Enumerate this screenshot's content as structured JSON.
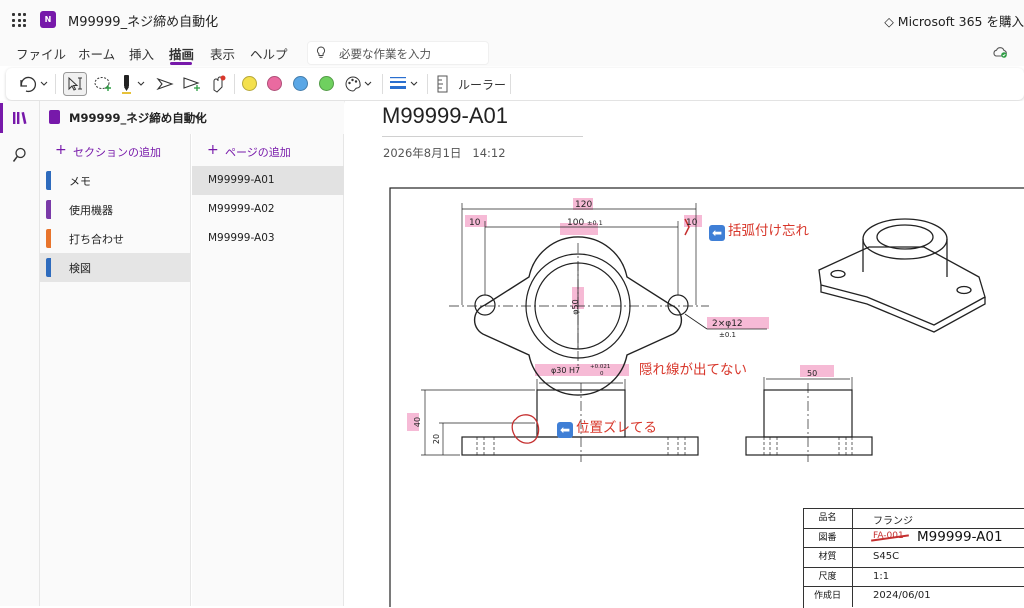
{
  "titlebar": {
    "app_badge": "N",
    "doc_title": "M99999_ネジ締め自動化",
    "m365_label": "Microsoft 365 を購入"
  },
  "menu": {
    "items": [
      "ファイル",
      "ホーム",
      "挿入",
      "描画",
      "表示",
      "ヘルプ"
    ],
    "active": "描画"
  },
  "search": {
    "placeholder": "必要な作業を入力"
  },
  "toolbar": {
    "ruler_label": "ルーラー",
    "pen_colors": [
      "#f4e04d",
      "#ea6aa0",
      "#5aa7e6",
      "#6fd05f"
    ]
  },
  "notebook": {
    "name": "M99999_ネジ締め自動化"
  },
  "sections": {
    "add_label": "セクションの追加",
    "items": [
      {
        "label": "メモ",
        "color": "#2e6bbd"
      },
      {
        "label": "使用機器",
        "color": "#7a3aa8"
      },
      {
        "label": "打ち合わせ",
        "color": "#e8742c"
      },
      {
        "label": "検図",
        "color": "#2e6bbd",
        "selected": true
      }
    ]
  },
  "pages": {
    "add_label": "ページの追加",
    "items": [
      {
        "label": "M99999-A01",
        "selected": true
      },
      {
        "label": "M99999-A02"
      },
      {
        "label": "M99999-A03"
      }
    ]
  },
  "page": {
    "title": "M99999-A01",
    "date": "2026年8月1日",
    "time": "14:12"
  },
  "drawing": {
    "dims": {
      "overall": "120",
      "center": "100",
      "center_tol": "±0.1",
      "edge_left": "10",
      "edge_right": "10",
      "bore": "φ50",
      "holes": "2×φ12",
      "holes_tol": "±0.1",
      "boss": "φ30 H7",
      "boss_tol_upper": "+0.021",
      "boss_tol_lower": "0",
      "height": "40",
      "base_h": "20",
      "side_w": "50"
    },
    "annotations": {
      "bracket": "括弧付け忘れ",
      "hidden_line": "隠れ線が出てない",
      "offset": "位置ズレてる"
    }
  },
  "title_block": {
    "rows": [
      {
        "key": "品名",
        "value": "フランジ"
      },
      {
        "key": "図番",
        "value_old": "FA-001",
        "value": "M99999-A01"
      },
      {
        "key": "材質",
        "value": "S45C"
      },
      {
        "key": "尺度",
        "value": "1:1"
      },
      {
        "key": "作成日",
        "value": "2024/06/01"
      }
    ]
  }
}
